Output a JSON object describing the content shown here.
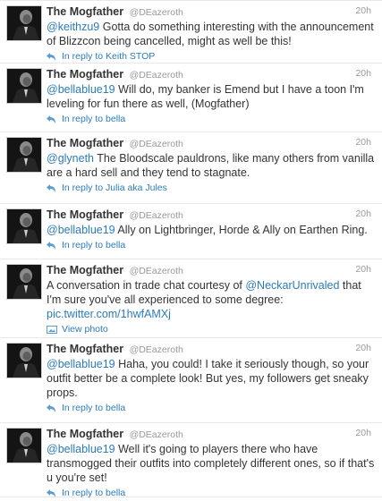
{
  "tweets": [
    {
      "name": "The Mogfather",
      "handle": "@DEazeroth",
      "time": "20h",
      "mention": "@keithzu9",
      "text": " Gotta do something interesting with the announcement of Blizzcon being cancelled, might as well be this!",
      "reply": "In reply to Keith STOP",
      "reply_icon": "reply-arrow-icon"
    },
    {
      "name": "The Mogfather",
      "handle": "@DEazeroth",
      "time": "20h",
      "mention": "@bellablue19",
      "text": " Will do, my banker is Emend but I have a toon I'm leveling for fun there as well, (Mogfather)",
      "reply": "In reply to bella",
      "reply_icon": "reply-arrow-icon"
    },
    {
      "name": "The Mogfather",
      "handle": "@DEazeroth",
      "time": "20h",
      "mention": "@glyneth",
      "text": " The Bloodscale pauldrons, like many others from vanilla are a hard sell and they tend to stagnate.",
      "reply": "In reply to Julia aka Jules",
      "reply_icon": "reply-arrow-icon"
    },
    {
      "name": "The Mogfather",
      "handle": "@DEazeroth",
      "time": "20h",
      "mention": "@bellablue19",
      "text": " Ally on Lightbringer, Horde & Ally on Earthen Ring.",
      "reply": "In reply to bella",
      "reply_icon": "reply-arrow-icon"
    },
    {
      "name": "The Mogfather",
      "handle": "@DEazeroth",
      "time": "20h",
      "text_before": "A conversation in trade chat courtesy of ",
      "mention": "@NeckarUnrivaled",
      "text_after": " that I'm sure you've all experienced to some degree: ",
      "link": "pic.twitter.com/1hwfAMXj",
      "view_photo": "View photo",
      "photo_icon": "photo-icon"
    },
    {
      "name": "The Mogfather",
      "handle": "@DEazeroth",
      "time": "20h",
      "mention": "@bellablue19",
      "text": " Haha, you could! I take it seriously though, so your outfit better be a complete look! But yes, my followers get sneaky props.",
      "reply": "In reply to bella",
      "reply_icon": "reply-arrow-icon"
    },
    {
      "name": "The Mogfather",
      "handle": "@DEazeroth",
      "time": "20h",
      "mention": "@bellablue19",
      "text": " Well it's going to players there who have transmogged their outfits into completely different ones, so if that's u you're set!",
      "reply": "In reply to bella",
      "reply_icon": "reply-arrow-icon"
    }
  ]
}
